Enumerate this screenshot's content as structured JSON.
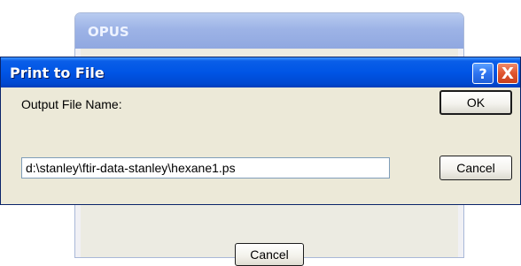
{
  "background_window": {
    "title": "OPUS",
    "cancel_label": "Cancel"
  },
  "dialog": {
    "title": "Print to File",
    "help_symbol": "?",
    "close_symbol": "X",
    "output_label": "Output File Name:",
    "file_name_value": "d:\\stanley\\ftir-data-stanley\\hexane1.ps",
    "ok_label": "OK",
    "cancel_label": "Cancel"
  },
  "colors": {
    "title_bar": "#0055e5",
    "dialog_face": "#ece9d8",
    "close_button": "#e0552f"
  }
}
